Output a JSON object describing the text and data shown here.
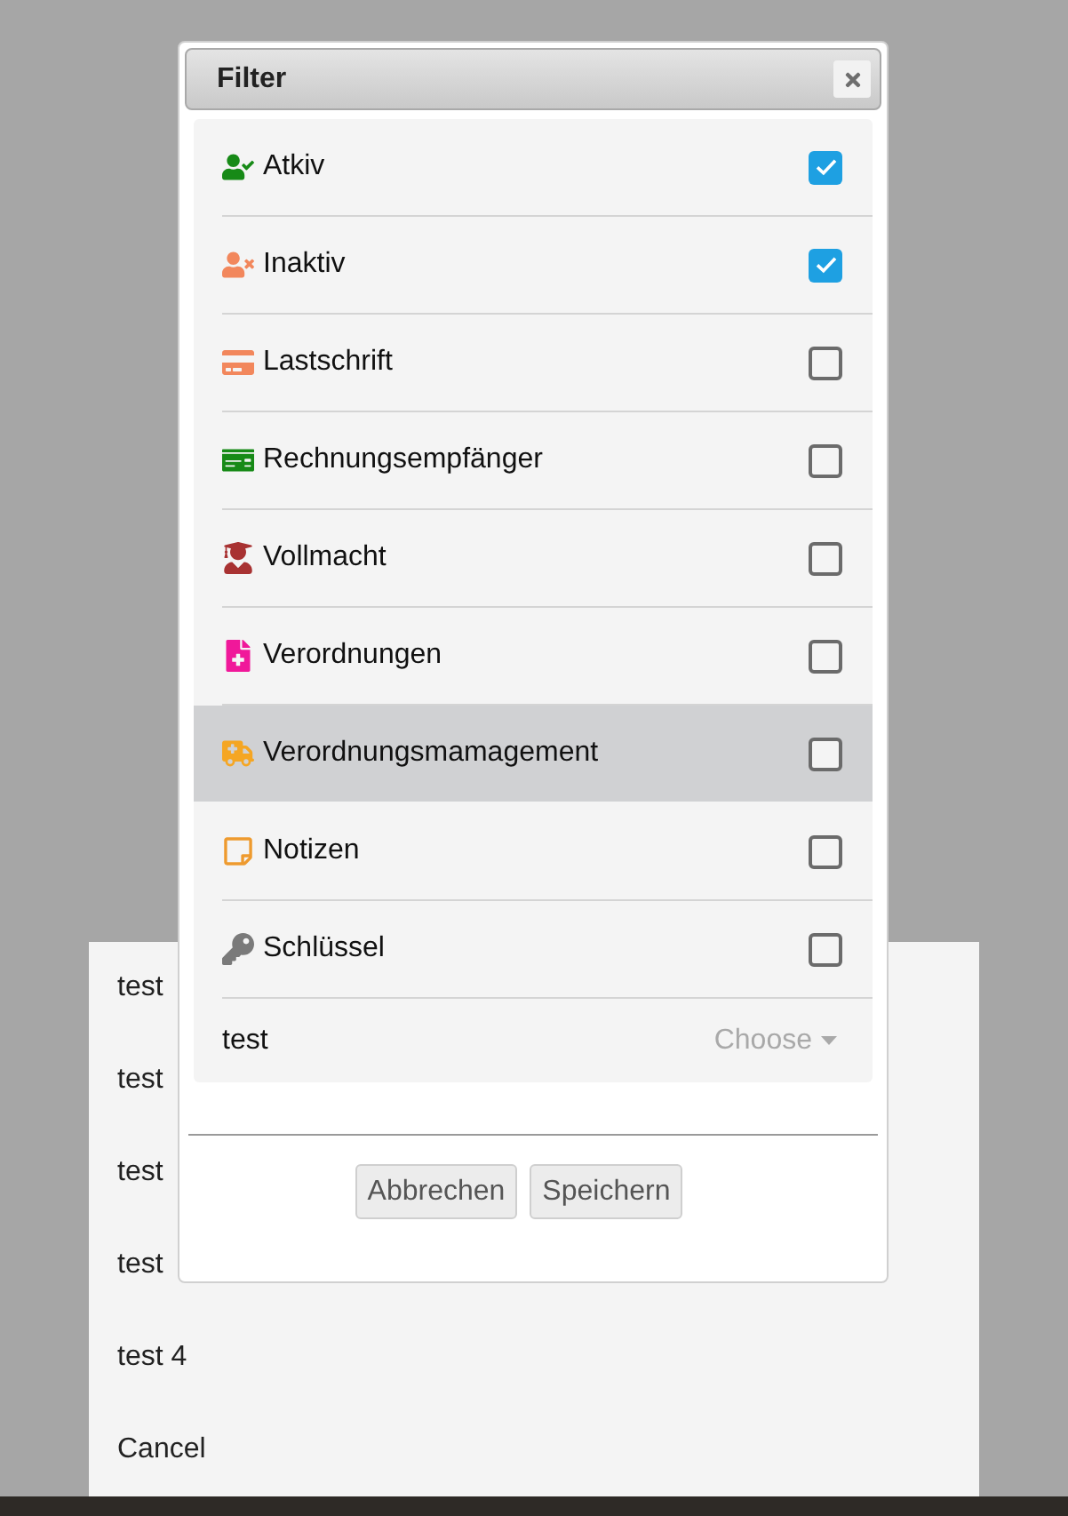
{
  "dialog": {
    "title": "Filter"
  },
  "filters": [
    {
      "label": "Atkiv",
      "checked": true,
      "selected": false
    },
    {
      "label": "Inaktiv",
      "checked": true,
      "selected": false
    },
    {
      "label": "Lastschrift",
      "checked": false,
      "selected": false
    },
    {
      "label": "Rechnungsempfänger",
      "checked": false,
      "selected": false
    },
    {
      "label": "Vollmacht",
      "checked": false,
      "selected": false
    },
    {
      "label": "Verordnungen",
      "checked": false,
      "selected": false
    },
    {
      "label": "Verordnungsmamagement",
      "checked": false,
      "selected": true
    },
    {
      "label": "Notizen",
      "checked": false,
      "selected": false
    },
    {
      "label": "Schlüssel",
      "checked": false,
      "selected": false
    }
  ],
  "select_row": {
    "label": "test",
    "placeholder": "Choose"
  },
  "buttons": [
    "Abbrechen",
    "Speichern"
  ],
  "action_sheet": {
    "items": [
      "test",
      "test",
      "test",
      "test",
      "test 4"
    ],
    "cancel": "Cancel"
  }
}
